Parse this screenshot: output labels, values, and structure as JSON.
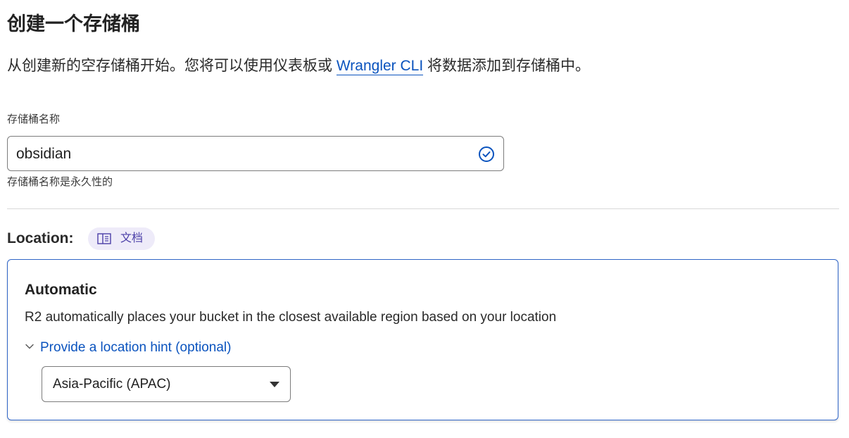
{
  "page": {
    "title": "创建一个存储桶",
    "intro_before": "从创建新的空存储桶开始。您将可以使用仪表板或 ",
    "intro_link": "Wrangler CLI",
    "intro_after": " 将数据添加到存储桶中。"
  },
  "bucket_name": {
    "label": "存储桶名称",
    "value": "obsidian",
    "helper": "存储桶名称是永久性的",
    "status_icon": "check-circle-icon"
  },
  "location": {
    "label": "Location:",
    "docs_pill": "文档",
    "docs_icon": "book-icon",
    "card": {
      "title": "Automatic",
      "description": "R2 automatically places your bucket in the closest available region based on your location",
      "hint_toggle": "Provide a location hint (optional)",
      "hint_icon": "chevron-down-icon",
      "select_value": "Asia-Pacific (APAC)",
      "select_icon": "caret-down-icon"
    }
  },
  "colors": {
    "link": "#0a53be",
    "accent_border": "#2f65c7",
    "pill_bg": "#eeebf9",
    "pill_text": "#4b3fa8"
  }
}
